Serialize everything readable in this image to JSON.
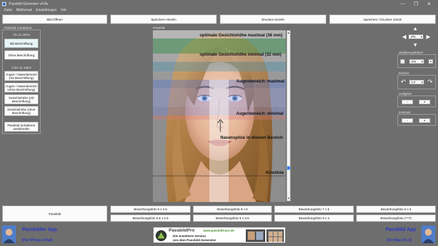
{
  "window": {
    "title": "Passbild-Generator v4.8a",
    "minimize": "—",
    "maximize": "❐",
    "close": "✕"
  },
  "menu": [
    "Datei",
    "Bildformat",
    "Einstellungen",
    "Info"
  ],
  "toolbar": {
    "open": "Bild Öffnen",
    "save_single": "Speichern einzeln",
    "print_single": "Drucken einzeln",
    "save_print_10x15": "Speichern / Drucken 10x15"
  },
  "template_panel": {
    "label": "Passbild Schablone",
    "age_12_label": "Ab 12 Jahre",
    "with_labels": "Mit Beschriftung",
    "without_labels": "Ohne Beschriftung",
    "age_0_11_label": "0 bis 11 Jahre",
    "eye_nose_with": "Augen / Nasenbereich (mit Beschriftung)",
    "eye_nose_without": "Augen / Nasenbereich (ohne Beschriftung)",
    "face_height_with": "Gesichtshöhe (mit Beschriftung)",
    "face_height_without": "Gesichtshöhe (ohne Beschriftung)",
    "hide_template": "Passbild Schablone ausblenden"
  },
  "photo": {
    "label": "Passbild",
    "overlay_labels": {
      "max_face": "optimale Gesichtshöhe maximal (36 mm)",
      "min_face": "optimale Gesichtshöhe minimal (32 mm)",
      "eye_max": "Augenbereich: maximal",
      "eye_min": "Augenbereich: minimal",
      "nose": "Nasenspitze in diesem Bereich",
      "chin": "Kinnlinie"
    }
  },
  "right_panel": {
    "move_step": "1Px",
    "scaling_label": "Skalierungsfaktor",
    "scaling_value": "10x",
    "rotate_label": "Drehen",
    "rotate_value": "1.0",
    "brightness_label": "Helligkeit",
    "contrast_label": "Kontrast",
    "minus": "-",
    "plus": "+"
  },
  "bottom": {
    "passbild_button": "Passbild",
    "formats_row1": [
      "Bewerbungsfoto 6 x 4.5",
      "Bewerbungsfoto 8 x 6",
      "Bewerbungsfoto 7 x 5",
      "Bewerbungsfoto 8 x 5"
    ],
    "formats_row2": [
      "Bewerbungsfoto 6.5 x 4.5",
      "Bewerbungsfoto 5 x 3.5",
      "Bewerbungsfoto 5 x 4",
      "Bewerbungsfoto (???)"
    ]
  },
  "footer": {
    "left_title": "Passbilder App",
    "left_sub": "(Für iPhone / iPad)",
    "right_title": "Passbild App",
    "right_sub": "(Für Mac OS X)",
    "banner_brand": "PassbildPro",
    "banner_url": "www.passbild-pro.de",
    "banner_line1": "Die erweiterte Version",
    "banner_line2": "von dem Passbild-Generator"
  }
}
